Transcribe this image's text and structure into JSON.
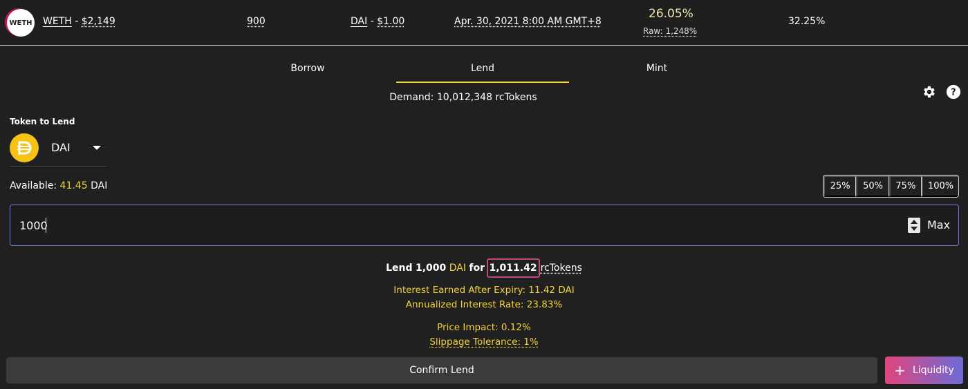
{
  "market": {
    "logo_text": "WETH",
    "collateral_token": "WETH",
    "collateral_price": "$2,149",
    "separator": "-",
    "collateral_ratio_value": "900",
    "debt_token": "DAI",
    "debt_price": "$1.00",
    "expiry": "Apr. 30, 2021 8:00 AM GMT+8",
    "apr": "26.05%",
    "raw": "Raw: 1,248%",
    "ratio_pct": "32.25%"
  },
  "tabs": [
    {
      "label": "Borrow",
      "active": false
    },
    {
      "label": "Lend",
      "active": true
    },
    {
      "label": "Mint",
      "active": false
    }
  ],
  "demand": "Demand: 10,012,348 rcTokens",
  "icons": {
    "settings": "gear-icon",
    "help": "help-icon"
  },
  "lend": {
    "token_label": "Token to Lend",
    "token": "DAI",
    "available_label": "Available:",
    "available_amount": "41.45",
    "available_token": "DAI",
    "percent_buttons": [
      "25%",
      "50%",
      "75%",
      "100%"
    ],
    "amount_value": "1000",
    "max_label": "Max"
  },
  "summary": {
    "prefix": "Lend",
    "amount": "1,000",
    "token": "DAI",
    "for": "for",
    "receive": "1,011.42",
    "receive_token": "rcTokens",
    "interest_earned": "Interest Earned After Expiry: 11.42 DAI",
    "annualized": "Annualized Interest Rate: 23.83%",
    "price_impact": "Price Impact: 0.12%",
    "slippage": "Slippage Tolerance: 1%"
  },
  "buttons": {
    "confirm": "Confirm Lend",
    "liquidity": "Liquidity"
  },
  "colors": {
    "accent_yellow": "#f5d33a",
    "highlight_pink": "#c2487d",
    "input_border": "#6c7be0"
  }
}
